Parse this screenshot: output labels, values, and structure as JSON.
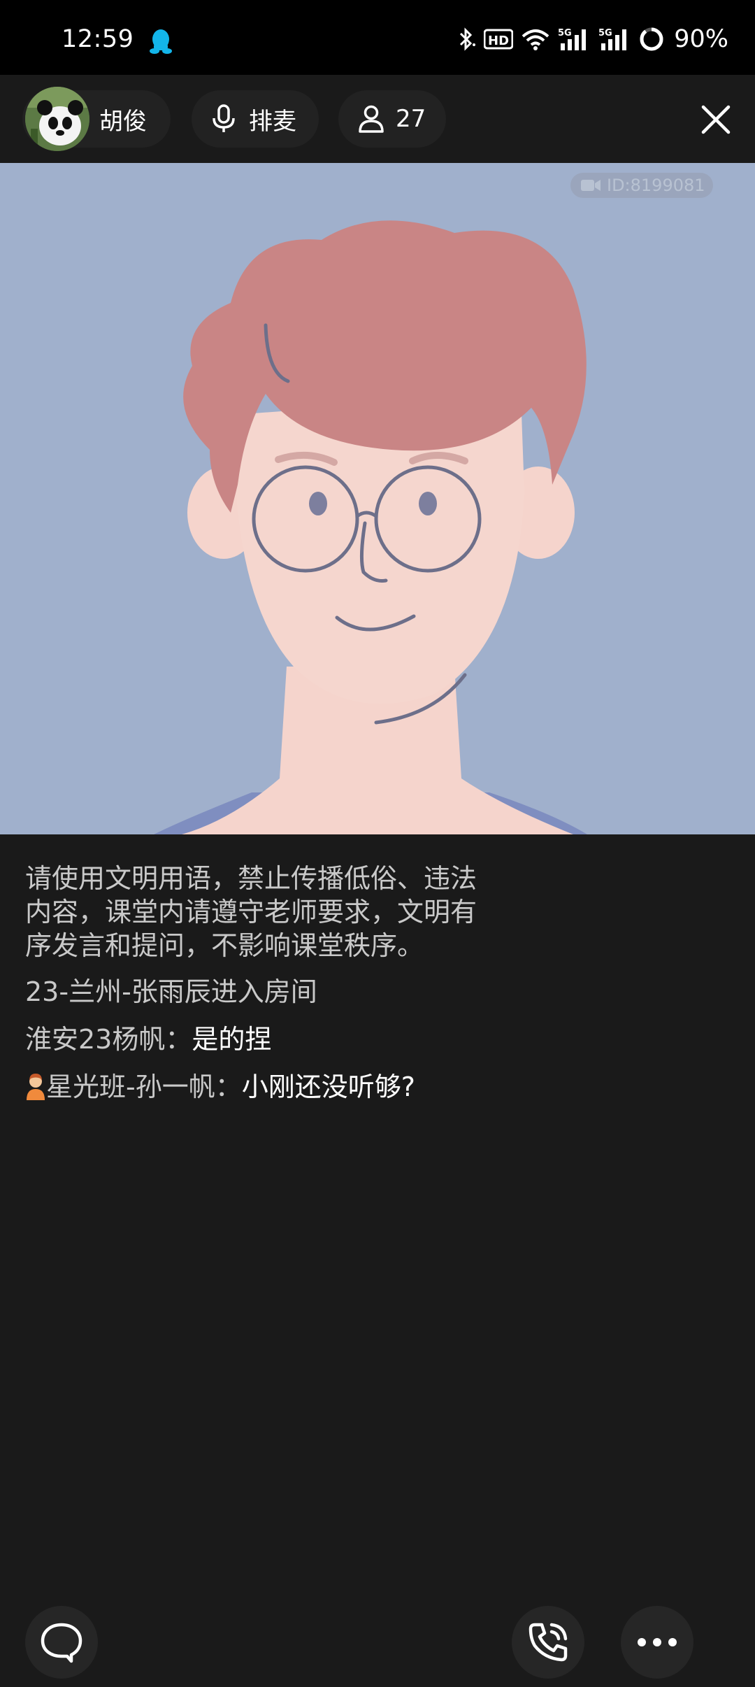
{
  "status_bar": {
    "time": "12:59",
    "battery": "90%",
    "icons": [
      "qq-icon",
      "bluetooth-icon",
      "hd-voice-icon",
      "wifi-icon",
      "signal-5g-icon",
      "signal-5g-icon",
      "battery-ring-icon"
    ]
  },
  "top_bar": {
    "host_name": "胡俊",
    "mic_label": "排麦",
    "online_count": "27"
  },
  "video": {
    "room_id": "ID:8199081",
    "background_color": "#a0b0cc"
  },
  "chat": {
    "notice_lines": [
      "请使用文明用语，禁止传播低俗、违法",
      "内容，课堂内请遵守老师要求，文明有",
      "序发言和提问，不影响课堂秩序。"
    ],
    "messages": [
      {
        "type": "system",
        "text": "23-兰州-张雨辰进入房间"
      },
      {
        "type": "chat",
        "sender": "淮安23杨帆：",
        "text": "是的捏"
      },
      {
        "type": "chat",
        "sender": "星光班-孙一帆：",
        "text": "小刚还没听够?",
        "badge": "student-badge-icon"
      }
    ]
  },
  "colors": {
    "background": "#1a1a1a",
    "pill": "#222222",
    "hair": "#c98585",
    "skin": "#f5d4cc"
  }
}
